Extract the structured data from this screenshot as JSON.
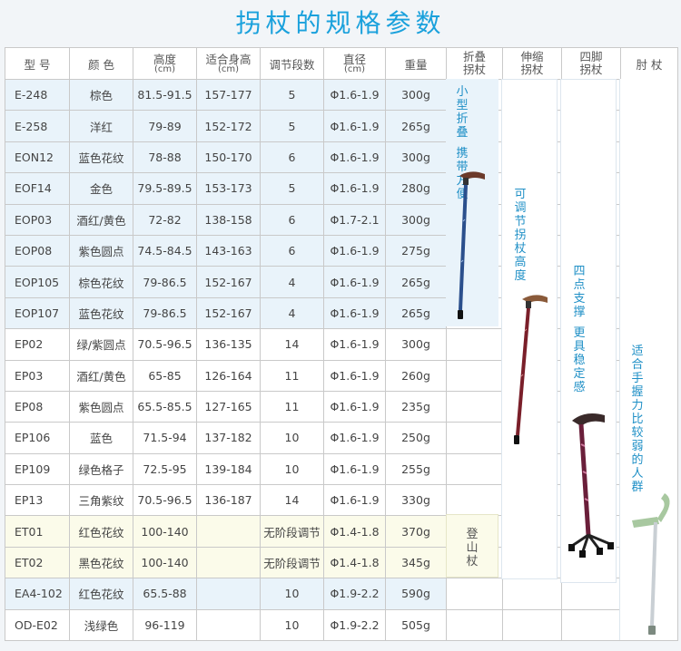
{
  "title": "拐杖的规格参数",
  "headers": {
    "model": "型 号",
    "color": "颜 色",
    "height": "高度",
    "height_unit": "(cm)",
    "suitable": "适合身高",
    "suitable_unit": "(cm)",
    "levels": "调节段数",
    "diameter": "直径",
    "diameter_unit": "(cm)",
    "weight": "重量",
    "cat_fold": [
      "折叠",
      "拐杖"
    ],
    "cat_telescopic": [
      "伸缩",
      "拐杖"
    ],
    "cat_quad": [
      "四脚",
      "拐杖"
    ],
    "cat_elbow": "肘 杖"
  },
  "rows": [
    {
      "model": "E-248",
      "color": "棕色",
      "height": "81.5-91.5",
      "suitable": "157-177",
      "levels": "5",
      "diameter": "Φ1.6-1.9",
      "weight": "300g"
    },
    {
      "model": "E-258",
      "color": "洋红",
      "height": "79-89",
      "suitable": "152-172",
      "levels": "5",
      "diameter": "Φ1.6-1.9",
      "weight": "265g"
    },
    {
      "model": "EON12",
      "color": "蓝色花纹",
      "height": "78-88",
      "suitable": "150-170",
      "levels": "6",
      "diameter": "Φ1.6-1.9",
      "weight": "300g"
    },
    {
      "model": "EOF14",
      "color": "金色",
      "height": "79.5-89.5",
      "suitable": "153-173",
      "levels": "5",
      "diameter": "Φ1.6-1.9",
      "weight": "280g"
    },
    {
      "model": "EOP03",
      "color": "酒红/黄色",
      "height": "72-82",
      "suitable": "138-158",
      "levels": "6",
      "diameter": "Φ1.7-2.1",
      "weight": "300g"
    },
    {
      "model": "EOP08",
      "color": "紫色圆点",
      "height": "74.5-84.5",
      "suitable": "143-163",
      "levels": "6",
      "diameter": "Φ1.6-1.9",
      "weight": "275g"
    },
    {
      "model": "EOP105",
      "color": "棕色花纹",
      "height": "79-86.5",
      "suitable": "152-167",
      "levels": "4",
      "diameter": "Φ1.6-1.9",
      "weight": "265g"
    },
    {
      "model": "EOP107",
      "color": "蓝色花纹",
      "height": "79-86.5",
      "suitable": "152-167",
      "levels": "4",
      "diameter": "Φ1.6-1.9",
      "weight": "265g"
    },
    {
      "model": "EP02",
      "color": "绿/紫圆点",
      "height": "70.5-96.5",
      "suitable": "136-135",
      "levels": "14",
      "diameter": "Φ1.6-1.9",
      "weight": "300g"
    },
    {
      "model": "EP03",
      "color": "酒红/黄色",
      "height": "65-85",
      "suitable": "126-164",
      "levels": "11",
      "diameter": "Φ1.6-1.9",
      "weight": "260g"
    },
    {
      "model": "EP08",
      "color": "紫色圆点",
      "height": "65.5-85.5",
      "suitable": "127-165",
      "levels": "11",
      "diameter": "Φ1.6-1.9",
      "weight": "235g"
    },
    {
      "model": "EP106",
      "color": "蓝色",
      "height": "71.5-94",
      "suitable": "137-182",
      "levels": "10",
      "diameter": "Φ1.6-1.9",
      "weight": "250g"
    },
    {
      "model": "EP109",
      "color": "绿色格子",
      "height": "72.5-95",
      "suitable": "139-184",
      "levels": "10",
      "diameter": "Φ1.6-1.9",
      "weight": "255g"
    },
    {
      "model": "EP13",
      "color": "三角紫纹",
      "height": "70.5-96.5",
      "suitable": "136-187",
      "levels": "14",
      "diameter": "Φ1.6-1.9",
      "weight": "330g"
    },
    {
      "model": "ET01",
      "color": "红色花纹",
      "height": "100-140",
      "suitable": "",
      "levels": "无阶段调节",
      "diameter": "Φ1.4-1.8",
      "weight": "370g"
    },
    {
      "model": "ET02",
      "color": "黑色花纹",
      "height": "100-140",
      "suitable": "",
      "levels": "无阶段调节",
      "diameter": "Φ1.4-1.8",
      "weight": "345g"
    },
    {
      "model": "EA4-102",
      "color": "红色花纹",
      "height": "65.5-88",
      "suitable": "",
      "levels": "10",
      "diameter": "Φ1.9-2.2",
      "weight": "590g"
    },
    {
      "model": "OD-E02",
      "color": "浅绿色",
      "height": "96-119",
      "suitable": "",
      "levels": "10",
      "diameter": "Φ1.9-2.2",
      "weight": "505g"
    }
  ],
  "notes": {
    "fold_a": "小型折叠",
    "fold_b": "携带方便",
    "telescopic": "可调节拐杖高度",
    "quad_a": "四点支撑",
    "quad_b": "更具稳定感",
    "elbow": "适合手握力比较弱的人群",
    "trekking": "登山杖"
  },
  "colors": {
    "title": "#1aa1dc",
    "note": "#1e8fc6",
    "highlight_blue": "#e9f3fa",
    "highlight_yellow": "#fbfbea",
    "levels_red": "#c0392b"
  },
  "icons": [
    "folding-cane-icon",
    "telescopic-cane-icon",
    "quad-cane-icon",
    "elbow-crutch-icon"
  ]
}
